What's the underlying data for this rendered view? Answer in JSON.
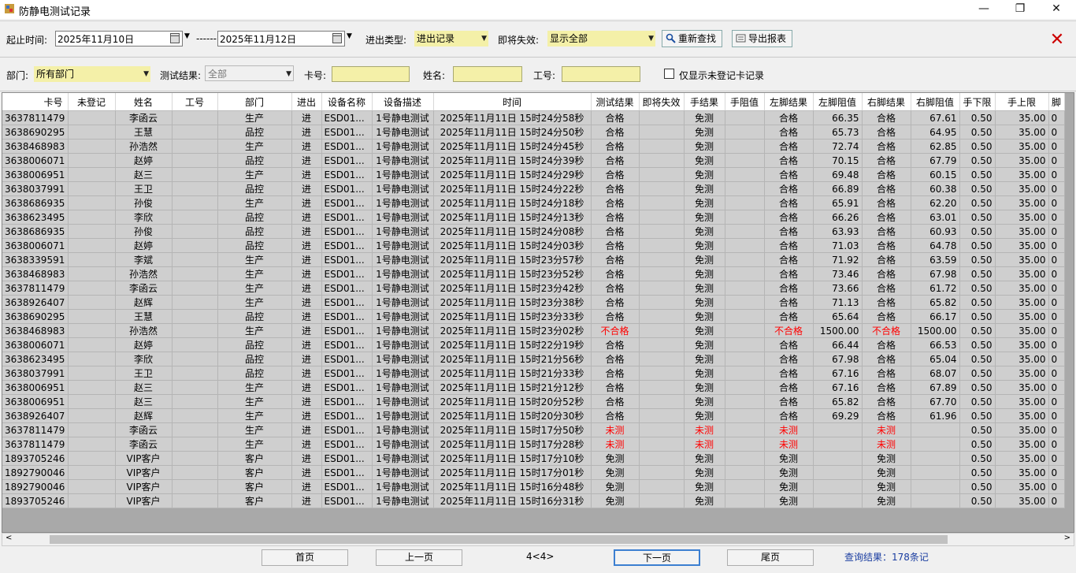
{
  "window": {
    "title": "防静电测试记录"
  },
  "toolbar": {
    "start_label": "起止时间:",
    "start_date": "2025年11月10日",
    "separator": "------",
    "end_date": "2025年11月12日",
    "inout_label": "进出类型:",
    "inout_value": "进出记录",
    "expire_label": "即将失效:",
    "expire_value": "显示全部",
    "search_label": "重新查找",
    "export_label": "导出报表"
  },
  "filters": {
    "dept_label": "部门:",
    "dept_value": "所有部门",
    "result_label": "测试结果:",
    "result_value": "全部",
    "card_label": "卡号:",
    "name_label": "姓名:",
    "empno_label": "工号:",
    "unreg_label": "仅显示未登记卡记录"
  },
  "table": {
    "columns": [
      "卡号",
      "未登记",
      "姓名",
      "工号",
      "部门",
      "进出",
      "设备名称",
      "设备描述",
      "时间",
      "测试结果",
      "即将失效",
      "手结果",
      "手阻值",
      "左脚结果",
      "左脚阻值",
      "右脚结果",
      "右脚阻值",
      "手下限",
      "手上限",
      "脚"
    ],
    "rows": [
      [
        "3637811479",
        "",
        "李函云",
        "",
        "生产",
        "进",
        "ESD01...",
        "1号静电测试",
        "2025年11月11日 15时24分58秒",
        "合格",
        "",
        "免测",
        "",
        "合格",
        "66.35",
        "合格",
        "67.61",
        "0.50",
        "35.00",
        "0"
      ],
      [
        "3638690295",
        "",
        "王慧",
        "",
        "品控",
        "进",
        "ESD01...",
        "1号静电测试",
        "2025年11月11日 15时24分50秒",
        "合格",
        "",
        "免测",
        "",
        "合格",
        "65.73",
        "合格",
        "64.95",
        "0.50",
        "35.00",
        "0"
      ],
      [
        "3638468983",
        "",
        "孙浩然",
        "",
        "生产",
        "进",
        "ESD01...",
        "1号静电测试",
        "2025年11月11日 15时24分45秒",
        "合格",
        "",
        "免测",
        "",
        "合格",
        "72.74",
        "合格",
        "62.85",
        "0.50",
        "35.00",
        "0"
      ],
      [
        "3638006071",
        "",
        "赵婷",
        "",
        "品控",
        "进",
        "ESD01...",
        "1号静电测试",
        "2025年11月11日 15时24分39秒",
        "合格",
        "",
        "免测",
        "",
        "合格",
        "70.15",
        "合格",
        "67.79",
        "0.50",
        "35.00",
        "0"
      ],
      [
        "3638006951",
        "",
        "赵三",
        "",
        "生产",
        "进",
        "ESD01...",
        "1号静电测试",
        "2025年11月11日 15时24分29秒",
        "合格",
        "",
        "免测",
        "",
        "合格",
        "69.48",
        "合格",
        "60.15",
        "0.50",
        "35.00",
        "0"
      ],
      [
        "3638037991",
        "",
        "王卫",
        "",
        "品控",
        "进",
        "ESD01...",
        "1号静电测试",
        "2025年11月11日 15时24分22秒",
        "合格",
        "",
        "免测",
        "",
        "合格",
        "66.89",
        "合格",
        "60.38",
        "0.50",
        "35.00",
        "0"
      ],
      [
        "3638686935",
        "",
        "孙俊",
        "",
        "生产",
        "进",
        "ESD01...",
        "1号静电测试",
        "2025年11月11日 15时24分18秒",
        "合格",
        "",
        "免测",
        "",
        "合格",
        "65.91",
        "合格",
        "62.20",
        "0.50",
        "35.00",
        "0"
      ],
      [
        "3638623495",
        "",
        "李欣",
        "",
        "品控",
        "进",
        "ESD01...",
        "1号静电测试",
        "2025年11月11日 15时24分13秒",
        "合格",
        "",
        "免测",
        "",
        "合格",
        "66.26",
        "合格",
        "63.01",
        "0.50",
        "35.00",
        "0"
      ],
      [
        "3638686935",
        "",
        "孙俊",
        "",
        "品控",
        "进",
        "ESD01...",
        "1号静电测试",
        "2025年11月11日 15时24分08秒",
        "合格",
        "",
        "免测",
        "",
        "合格",
        "63.93",
        "合格",
        "60.93",
        "0.50",
        "35.00",
        "0"
      ],
      [
        "3638006071",
        "",
        "赵婷",
        "",
        "品控",
        "进",
        "ESD01...",
        "1号静电测试",
        "2025年11月11日 15时24分03秒",
        "合格",
        "",
        "免测",
        "",
        "合格",
        "71.03",
        "合格",
        "64.78",
        "0.50",
        "35.00",
        "0"
      ],
      [
        "3638339591",
        "",
        "李斌",
        "",
        "生产",
        "进",
        "ESD01...",
        "1号静电测试",
        "2025年11月11日 15时23分57秒",
        "合格",
        "",
        "免测",
        "",
        "合格",
        "71.92",
        "合格",
        "63.59",
        "0.50",
        "35.00",
        "0"
      ],
      [
        "3638468983",
        "",
        "孙浩然",
        "",
        "生产",
        "进",
        "ESD01...",
        "1号静电测试",
        "2025年11月11日 15时23分52秒",
        "合格",
        "",
        "免测",
        "",
        "合格",
        "73.46",
        "合格",
        "67.98",
        "0.50",
        "35.00",
        "0"
      ],
      [
        "3637811479",
        "",
        "李函云",
        "",
        "生产",
        "进",
        "ESD01...",
        "1号静电测试",
        "2025年11月11日 15时23分42秒",
        "合格",
        "",
        "免测",
        "",
        "合格",
        "73.66",
        "合格",
        "61.72",
        "0.50",
        "35.00",
        "0"
      ],
      [
        "3638926407",
        "",
        "赵辉",
        "",
        "生产",
        "进",
        "ESD01...",
        "1号静电测试",
        "2025年11月11日 15时23分38秒",
        "合格",
        "",
        "免测",
        "",
        "合格",
        "71.13",
        "合格",
        "65.82",
        "0.50",
        "35.00",
        "0"
      ],
      [
        "3638690295",
        "",
        "王慧",
        "",
        "品控",
        "进",
        "ESD01...",
        "1号静电测试",
        "2025年11月11日 15时23分33秒",
        "合格",
        "",
        "免测",
        "",
        "合格",
        "65.64",
        "合格",
        "66.17",
        "0.50",
        "35.00",
        "0"
      ],
      [
        "3638468983",
        "",
        "孙浩然",
        "",
        "生产",
        "进",
        "ESD01...",
        "1号静电测试",
        "2025年11月11日 15时23分02秒",
        "不合格",
        "",
        "免测",
        "",
        "不合格",
        "1500.00",
        "不合格",
        "1500.00",
        "0.50",
        "35.00",
        "0"
      ],
      [
        "3638006071",
        "",
        "赵婷",
        "",
        "品控",
        "进",
        "ESD01...",
        "1号静电测试",
        "2025年11月11日 15时22分19秒",
        "合格",
        "",
        "免测",
        "",
        "合格",
        "66.44",
        "合格",
        "66.53",
        "0.50",
        "35.00",
        "0"
      ],
      [
        "3638623495",
        "",
        "李欣",
        "",
        "品控",
        "进",
        "ESD01...",
        "1号静电测试",
        "2025年11月11日 15时21分56秒",
        "合格",
        "",
        "免测",
        "",
        "合格",
        "67.98",
        "合格",
        "65.04",
        "0.50",
        "35.00",
        "0"
      ],
      [
        "3638037991",
        "",
        "王卫",
        "",
        "品控",
        "进",
        "ESD01...",
        "1号静电测试",
        "2025年11月11日 15时21分33秒",
        "合格",
        "",
        "免测",
        "",
        "合格",
        "67.16",
        "合格",
        "68.07",
        "0.50",
        "35.00",
        "0"
      ],
      [
        "3638006951",
        "",
        "赵三",
        "",
        "生产",
        "进",
        "ESD01...",
        "1号静电测试",
        "2025年11月11日 15时21分12秒",
        "合格",
        "",
        "免测",
        "",
        "合格",
        "67.16",
        "合格",
        "67.89",
        "0.50",
        "35.00",
        "0"
      ],
      [
        "3638006951",
        "",
        "赵三",
        "",
        "生产",
        "进",
        "ESD01...",
        "1号静电测试",
        "2025年11月11日 15时20分52秒",
        "合格",
        "",
        "免测",
        "",
        "合格",
        "65.82",
        "合格",
        "67.70",
        "0.50",
        "35.00",
        "0"
      ],
      [
        "3638926407",
        "",
        "赵辉",
        "",
        "生产",
        "进",
        "ESD01...",
        "1号静电测试",
        "2025年11月11日 15时20分30秒",
        "合格",
        "",
        "免测",
        "",
        "合格",
        "69.29",
        "合格",
        "61.96",
        "0.50",
        "35.00",
        "0"
      ],
      [
        "3637811479",
        "",
        "李函云",
        "",
        "生产",
        "进",
        "ESD01...",
        "1号静电测试",
        "2025年11月11日 15时17分50秒",
        "未测",
        "",
        "未测",
        "",
        "未测",
        "",
        "未测",
        "",
        "0.50",
        "35.00",
        "0"
      ],
      [
        "3637811479",
        "",
        "李函云",
        "",
        "生产",
        "进",
        "ESD01...",
        "1号静电测试",
        "2025年11月11日 15时17分28秒",
        "未测",
        "",
        "未测",
        "",
        "未测",
        "",
        "未测",
        "",
        "0.50",
        "35.00",
        "0"
      ],
      [
        "1893705246",
        "",
        "VIP客户",
        "",
        "客户",
        "进",
        "ESD01...",
        "1号静电测试",
        "2025年11月11日 15时17分10秒",
        "免测",
        "",
        "免测",
        "",
        "免测",
        "",
        "免测",
        "",
        "0.50",
        "35.00",
        "0"
      ],
      [
        "1892790046",
        "",
        "VIP客户",
        "",
        "客户",
        "进",
        "ESD01...",
        "1号静电测试",
        "2025年11月11日 15时17分01秒",
        "免测",
        "",
        "免测",
        "",
        "免测",
        "",
        "免测",
        "",
        "0.50",
        "35.00",
        "0"
      ],
      [
        "1892790046",
        "",
        "VIP客户",
        "",
        "客户",
        "进",
        "ESD01...",
        "1号静电测试",
        "2025年11月11日 15时16分48秒",
        "免测",
        "",
        "免测",
        "",
        "免测",
        "",
        "免测",
        "",
        "0.50",
        "35.00",
        "0"
      ],
      [
        "1893705246",
        "",
        "VIP客户",
        "",
        "客户",
        "进",
        "ESD01...",
        "1号静电测试",
        "2025年11月11日 15时16分31秒",
        "免测",
        "",
        "免测",
        "",
        "免测",
        "",
        "免测",
        "",
        "0.50",
        "35.00",
        "0"
      ]
    ]
  },
  "pager": {
    "first": "首页",
    "prev": "上一页",
    "page_info": "4<4>",
    "next": "下一页",
    "last": "尾页",
    "result": "查询结果：178条记"
  },
  "colors": {
    "highlight": "#f4f0a8",
    "fail": "#ff0000",
    "row_bg": "#cfcfcf"
  }
}
